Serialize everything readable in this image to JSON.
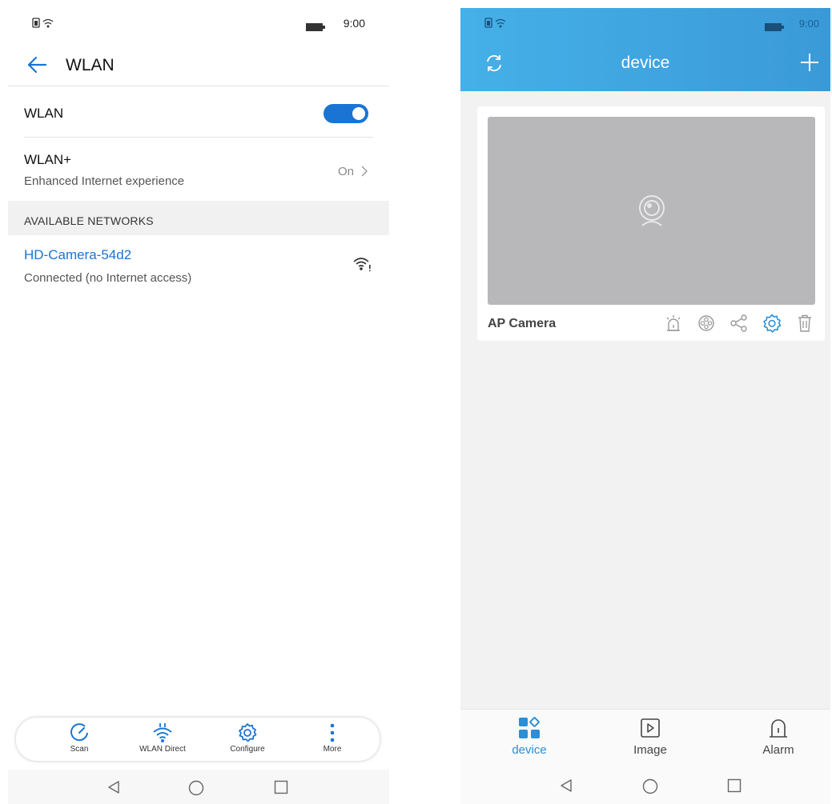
{
  "left": {
    "status_bar": {
      "time": "9:00"
    },
    "app_bar": {
      "title": "WLAN"
    },
    "wlan_row": {
      "label": "WLAN",
      "toggle_on": true
    },
    "wlan_plus_row": {
      "label": "WLAN+",
      "subtitle": "Enhanced Internet experience",
      "value": "On"
    },
    "section_header": "AVAILABLE NETWORKS",
    "networks": [
      {
        "name": "HD-Camera-54d2",
        "status": "Connected (no Internet access)"
      }
    ],
    "toolbar": [
      {
        "label": "Scan",
        "icon": "scan-icon"
      },
      {
        "label": "WLAN Direct",
        "icon": "wlan-direct-icon"
      },
      {
        "label": "Configure",
        "icon": "gear-icon"
      },
      {
        "label": "More",
        "icon": "more-vertical-icon"
      }
    ],
    "accent_color": "#1a74d3"
  },
  "right": {
    "status_bar": {
      "time": "9:00"
    },
    "header": {
      "title": "device"
    },
    "device_card": {
      "name": "AP Camera",
      "actions": [
        "alarm-icon",
        "playback-reel-icon",
        "share-icon",
        "settings-icon",
        "trash-icon"
      ]
    },
    "tabs": [
      {
        "label": "device",
        "icon": "device-grid-icon",
        "active": true
      },
      {
        "label": "Image",
        "icon": "play-box-icon",
        "active": false
      },
      {
        "label": "Alarm",
        "icon": "alarm-bell-icon",
        "active": false
      }
    ],
    "header_gradient": [
      "#45b0e8",
      "#3a9ad8"
    ],
    "active_tab_color": "#2a8fd6"
  }
}
